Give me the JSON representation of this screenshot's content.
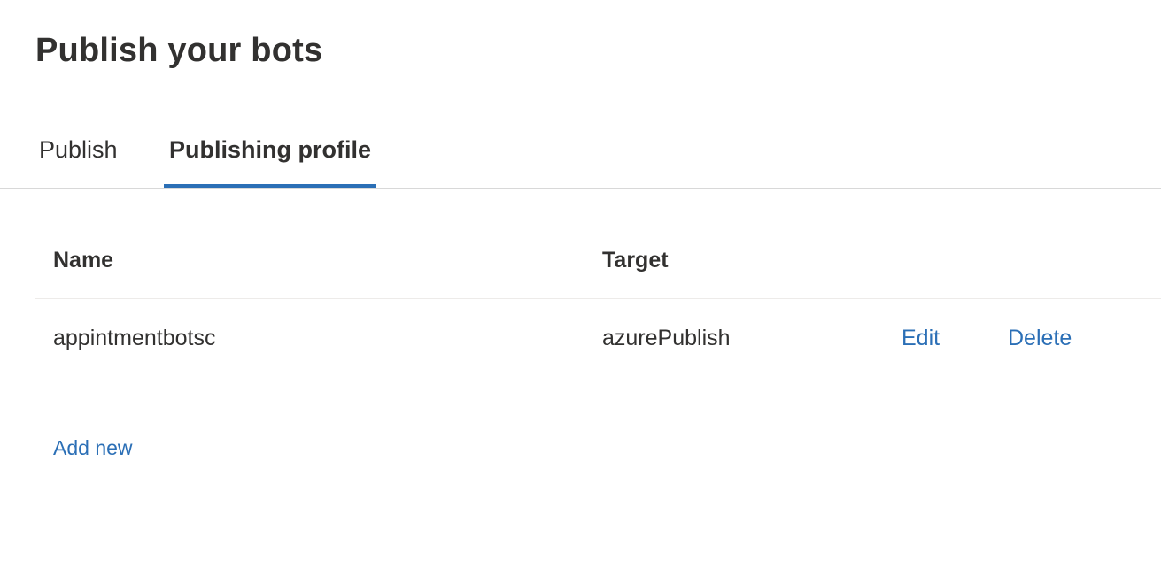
{
  "page": {
    "title": "Publish your bots"
  },
  "tabs": [
    {
      "label": "Publish",
      "active": false
    },
    {
      "label": "Publishing profile",
      "active": true
    }
  ],
  "table": {
    "columns": [
      "Name",
      "Target"
    ],
    "rows": [
      {
        "name": "appintmentbotsc",
        "target": "azurePublish",
        "edit_label": "Edit",
        "delete_label": "Delete"
      }
    ]
  },
  "actions": {
    "add_new_label": "Add new"
  },
  "colors": {
    "accent": "#2b6fb6",
    "text": "#323130",
    "divider": "#d8d8d8"
  }
}
